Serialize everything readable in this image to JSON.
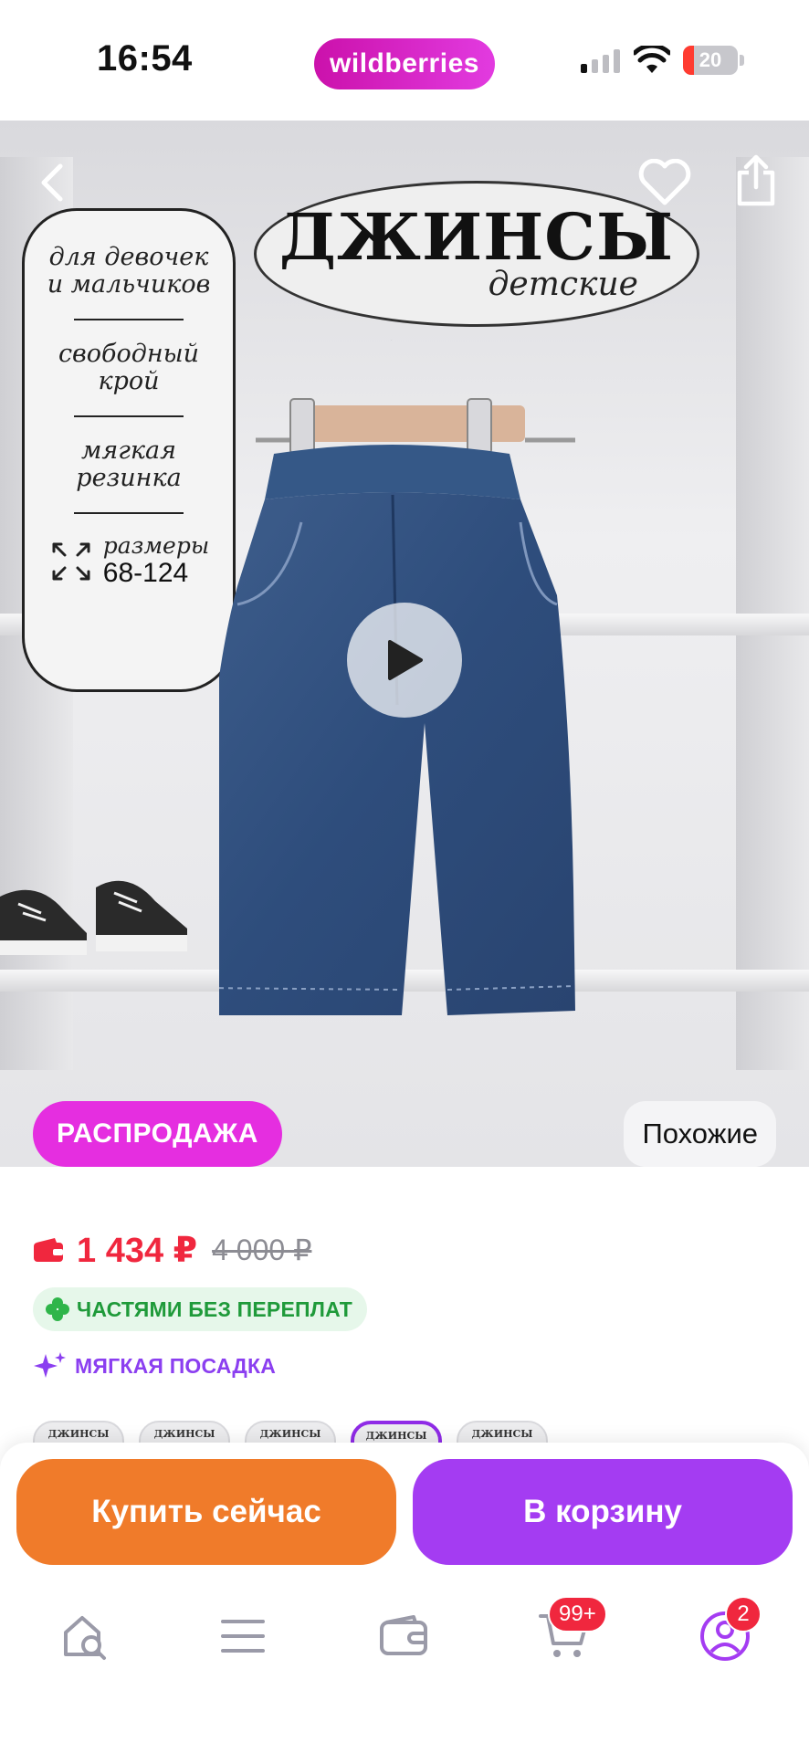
{
  "status_bar": {
    "time": "16:54",
    "battery": "20",
    "battery_level": 0.2
  },
  "brand": {
    "name": "wildberries"
  },
  "hero": {
    "info_card": {
      "line1": "для девочек",
      "line2": "и мальчиков",
      "line3": "свободный",
      "line4": "крой",
      "line5": "мягкая",
      "line6": "резинка",
      "sizes_label": "размеры",
      "sizes_value": "68-124"
    },
    "title_main": "ДЖИНСЫ",
    "title_sub": "детские",
    "sale_badge": "РАСПРОДАЖА",
    "similar_button": "Похожие"
  },
  "price": {
    "current": "1 434 ₽",
    "old": "4 000 ₽"
  },
  "installment": "ЧАСТЯМИ БЕЗ ПЕРЕПЛАТ",
  "feature": "МЯГКАЯ ПОСАДКА",
  "thumbnails": [
    {
      "label": "ДЖИНСЫ"
    },
    {
      "label": "ДЖИНСЫ"
    },
    {
      "label": "ДЖИНСЫ"
    },
    {
      "label": "ДЖИНСЫ"
    },
    {
      "label": "ДЖИНСЫ"
    }
  ],
  "actions": {
    "buy_now": "Купить сейчас",
    "add_to_cart": "В корзину"
  },
  "tabbar": {
    "items": [
      {
        "icon": "home-search-icon"
      },
      {
        "icon": "menu-icon"
      },
      {
        "icon": "wallet-icon"
      },
      {
        "icon": "cart-icon",
        "badge": "99+"
      },
      {
        "icon": "profile-icon",
        "badge": "2"
      }
    ]
  },
  "colors": {
    "brand": "#cb11ab",
    "sale": "#e52ee0",
    "price": "#f0273e",
    "buy_now": "#f07b2a",
    "add_to_cart": "#a43cf2",
    "installment": "#1f9a3a",
    "feature": "#8b3ff0"
  }
}
